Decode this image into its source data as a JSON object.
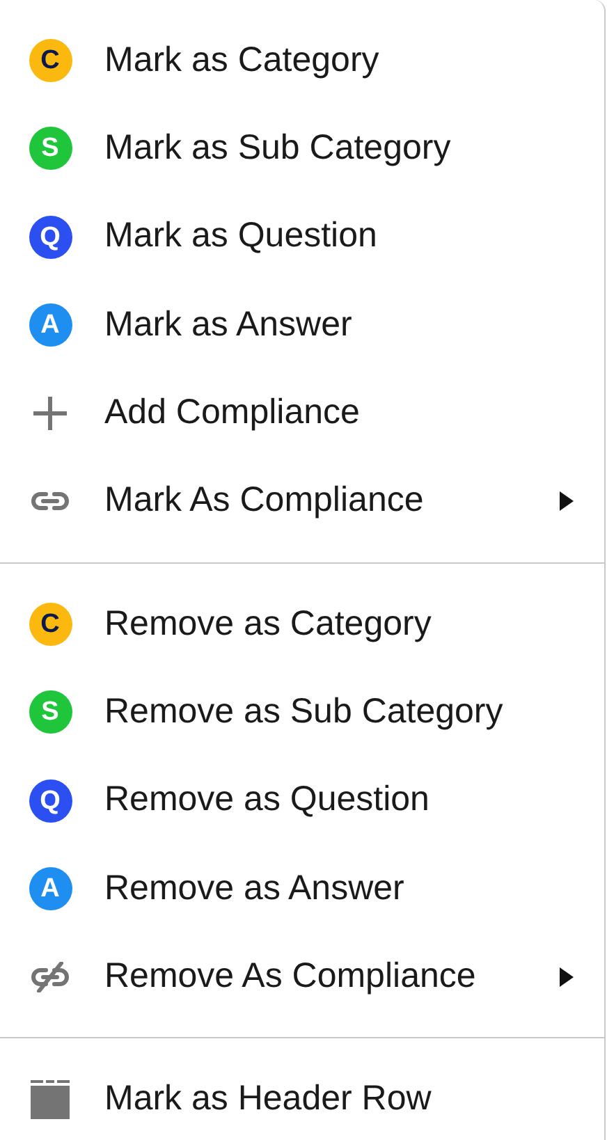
{
  "menu": {
    "sections": [
      {
        "items": [
          {
            "kind": "badge",
            "badge": "C",
            "color": "#fbb90f",
            "label": "Mark as Category",
            "has_submenu": false
          },
          {
            "kind": "badge",
            "badge": "S",
            "color": "#1fc53a",
            "label": "Mark as Sub Category",
            "has_submenu": false
          },
          {
            "kind": "badge",
            "badge": "Q",
            "color": "#2b4ff0",
            "label": "Mark as Question",
            "has_submenu": false
          },
          {
            "kind": "badge",
            "badge": "A",
            "color": "#1e8ff0",
            "label": "Mark as Answer",
            "has_submenu": false
          },
          {
            "kind": "plus",
            "label": "Add Compliance",
            "has_submenu": false
          },
          {
            "kind": "link",
            "label": "Mark As Compliance",
            "has_submenu": true
          }
        ]
      },
      {
        "items": [
          {
            "kind": "badge",
            "badge": "C",
            "color": "#fbb90f",
            "label": "Remove as Category",
            "has_submenu": false
          },
          {
            "kind": "badge",
            "badge": "S",
            "color": "#1fc53a",
            "label": "Remove as Sub Category",
            "has_submenu": false
          },
          {
            "kind": "badge",
            "badge": "Q",
            "color": "#2b4ff0",
            "label": "Remove as Question",
            "has_submenu": false
          },
          {
            "kind": "badge",
            "badge": "A",
            "color": "#1e8ff0",
            "label": "Remove as Answer",
            "has_submenu": false
          },
          {
            "kind": "unlink",
            "label": "Remove As Compliance",
            "has_submenu": true
          }
        ]
      },
      {
        "items": [
          {
            "kind": "header",
            "label": "Mark as Header Row",
            "has_submenu": false
          }
        ]
      }
    ]
  }
}
